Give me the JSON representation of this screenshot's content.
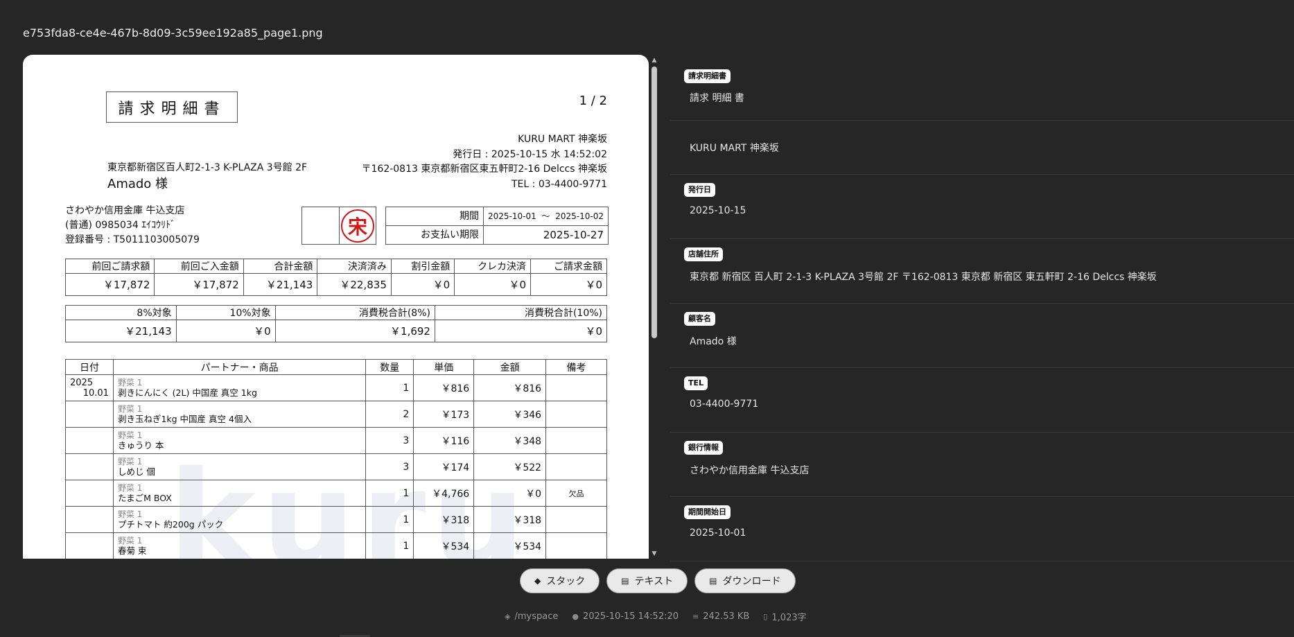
{
  "file_title": "e753fda8-ce4e-467b-8d09-3c59ee192a85_page1.png",
  "document": {
    "title": "請求明細書",
    "page": "1 / 2",
    "store_lines": [
      "KURU MART 神楽坂",
      "発行日 : 2025-10-15 水 14:52:02",
      "〒162-0813 東京都新宿区東五軒町2-16 Delccs 神楽坂",
      "TEL : 03-4400-9771"
    ],
    "customer_address": "東京都新宿区百人町2-1-3 K-PLAZA 3号館 2F",
    "customer_name": "Amado 様",
    "bank_lines": [
      "さわやか信用金庫 牛込支店",
      "(普通) 0985034 ｴｲｺｳﾘﾄﾞ",
      "登録番号 : T5011103005079"
    ],
    "seal_char": "宋",
    "period_label": "期間",
    "period_start": "2025-10-01",
    "period_tilde": "～",
    "period_end": "2025-10-02",
    "due_label": "お支払い期限",
    "due_date": "2025-10-27",
    "summary1": {
      "headers": [
        "前回ご請求額",
        "前回ご入金額",
        "合計金額",
        "決済済み",
        "割引金額",
        "クレカ決済",
        "ご請求金額"
      ],
      "values": [
        "￥17,872",
        "￥17,872",
        "￥21,143",
        "￥22,835",
        "￥0",
        "￥0",
        "￥0"
      ]
    },
    "summary2": {
      "headers": [
        "8%対象",
        "10%対象",
        "消費税合計(8%)",
        "消費税合計(10%)"
      ],
      "values": [
        "￥21,143",
        "￥0",
        "￥1,692",
        "￥0"
      ]
    },
    "items_headers": [
      "日付",
      "パートナー・商品",
      "数量",
      "単価",
      "金額",
      "備考"
    ],
    "items": [
      {
        "date_year": "2025",
        "date_day": "10.01",
        "category": "野菜 1",
        "name": "剥きにんにく (2L) 中国産 真空 1kg",
        "qty": "1",
        "unit": "￥816",
        "amount": "￥816",
        "note": ""
      },
      {
        "date_year": "",
        "date_day": "",
        "category": "野菜 1",
        "name": "剥き玉ねぎ1kg 中国産 真空 4個入",
        "qty": "2",
        "unit": "￥173",
        "amount": "￥346",
        "note": ""
      },
      {
        "date_year": "",
        "date_day": "",
        "category": "野菜 1",
        "name": "きゅうり 本",
        "qty": "3",
        "unit": "￥116",
        "amount": "￥348",
        "note": ""
      },
      {
        "date_year": "",
        "date_day": "",
        "category": "野菜 1",
        "name": "しめじ 個",
        "qty": "3",
        "unit": "￥174",
        "amount": "￥522",
        "note": ""
      },
      {
        "date_year": "",
        "date_day": "",
        "category": "野菜 1",
        "name": "たまごM BOX",
        "qty": "1",
        "unit": "￥4,766",
        "amount": "￥0",
        "note": "欠品"
      },
      {
        "date_year": "",
        "date_day": "",
        "category": "野菜 1",
        "name": "プチトマト 約200g パック",
        "qty": "1",
        "unit": "￥318",
        "amount": "￥318",
        "note": ""
      },
      {
        "date_year": "",
        "date_day": "",
        "category": "野菜 1",
        "name": "春菊 束",
        "qty": "1",
        "unit": "￥534",
        "amount": "￥534",
        "note": ""
      }
    ],
    "watermark": "kuru"
  },
  "fields": [
    {
      "label": "請求明細書",
      "value": "請求 明細 書"
    },
    {
      "label": "",
      "value": "KURU MART 神楽坂"
    },
    {
      "label": "発行日",
      "value": "2025-10-15"
    },
    {
      "label": "店舗住所",
      "value": "東京都 新宿区 百人町 2-1-3 K-PLAZA 3号館 2F 〒162-0813 東京都 新宿区 東五軒町 2-16 Delccs 神楽坂"
    },
    {
      "label": "顧客名",
      "value": "Amado 様"
    },
    {
      "label": "TEL",
      "value": "03-4400-9771"
    },
    {
      "label": "銀行情報",
      "value": "さわやか信用金庫 牛込支店"
    },
    {
      "label": "期間開始日",
      "value": "2025-10-01"
    }
  ],
  "actions": {
    "stack": "スタック",
    "text": "テキスト",
    "download": "ダウンロード"
  },
  "status": {
    "path": "/myspace",
    "timestamp": "2025-10-15 14:52:20",
    "size": "242.53 KB",
    "chars": "1,023字"
  }
}
